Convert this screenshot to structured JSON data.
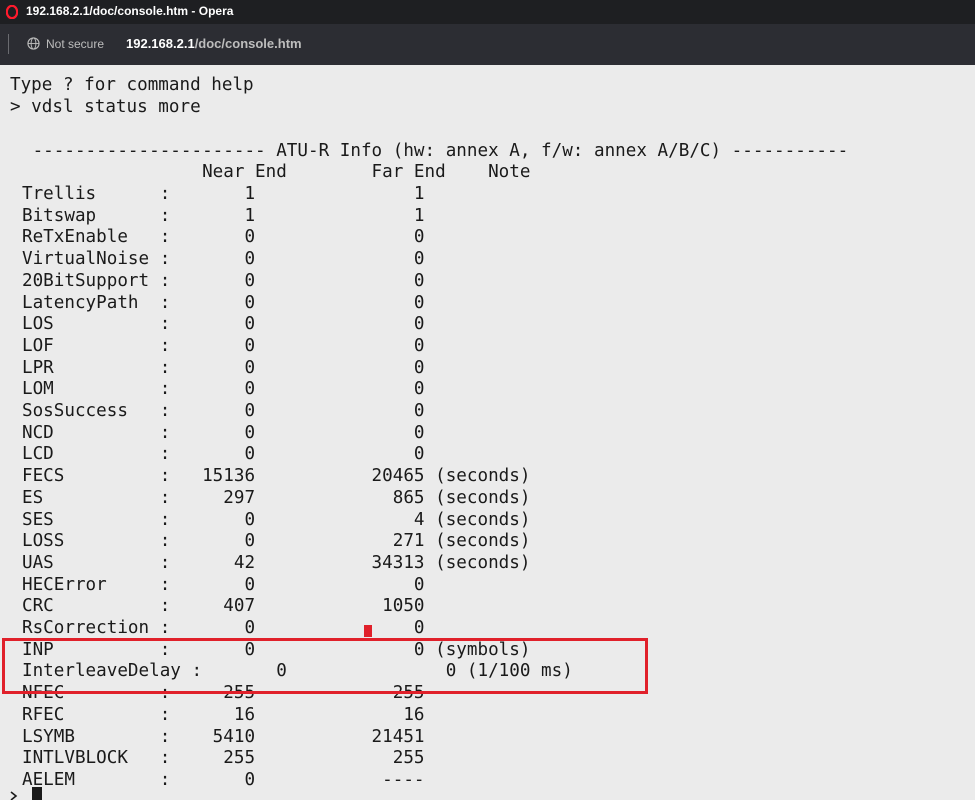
{
  "window": {
    "title": "192.168.2.1/doc/console.htm - Opera"
  },
  "address_bar": {
    "security_label": "Not secure",
    "url_host": "192.168.2.1",
    "url_path": "/doc/console.htm"
  },
  "console": {
    "lines": [
      "Type ? for command help",
      "> vdsl status more",
      "",
      " ---------------------- ATU-R Info (hw: annex A, f/w: annex A/B/C) -----------",
      "                 Near End        Far End    Note",
      "Trellis      :       1               1",
      "Bitswap      :       1               1",
      "ReTxEnable   :       0               0",
      "VirtualNoise :       0               0",
      "20BitSupport :       0               0",
      "LatencyPath  :       0               0",
      "LOS          :       0               0",
      "LOF          :       0               0",
      "LPR          :       0               0",
      "LOM          :       0               0",
      "SosSuccess   :       0               0",
      "NCD          :       0               0",
      "LCD          :       0               0",
      "FECS         :   15136           20465 (seconds)",
      "ES           :     297             865 (seconds)",
      "SES          :       0               4 (seconds)",
      "LOSS         :       0             271 (seconds)",
      "UAS          :      42           34313 (seconds)",
      "HECError     :       0               0",
      "CRC          :     407            1050",
      "RsCorrection :       0               0",
      "INP          :       0               0 (symbols)",
      "InterleaveDelay :       0               0 (1/100 ms)",
      "NFEC         :     255             255",
      "RFEC         :      16              16",
      "LSYMB        :    5410           21451",
      "INTLVBLOCK   :     255             255",
      "AELEM        :       0            ----"
    ]
  },
  "colors": {
    "highlight": "#e0202a",
    "console_bg": "#ebebeb",
    "titlebar_bg": "#1e1f22",
    "addrbar_bg": "#2c2d33"
  },
  "icons": {
    "browser_logo": "opera-logo-icon",
    "security": "globe-icon"
  }
}
